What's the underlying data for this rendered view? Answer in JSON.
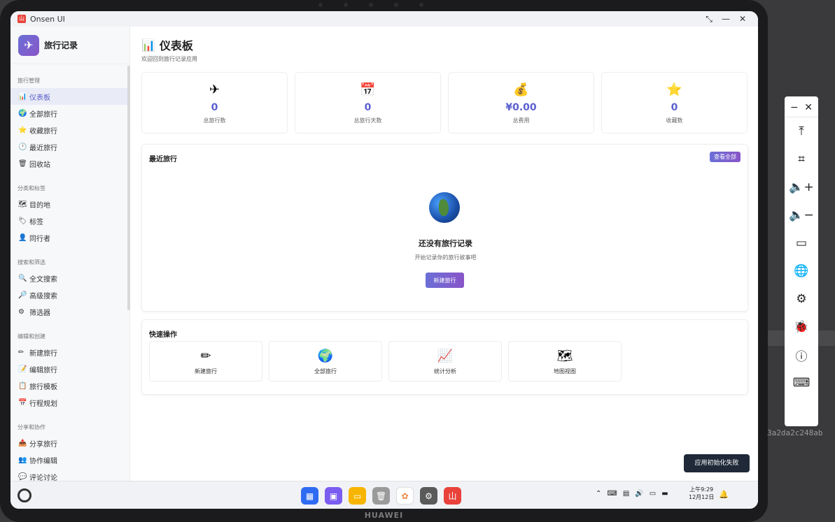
{
  "window": {
    "title": "Onsen UI"
  },
  "device": {
    "brand": "HUAWEI",
    "hash_text": "3a2da2c248ab"
  },
  "emulator": {
    "min": "−",
    "close": "✕",
    "tools": [
      "top-icon",
      "crop-icon",
      "volume-up-icon",
      "volume-down-icon",
      "battery-icon",
      "globe-icon",
      "settings-icon",
      "bug-icon",
      "info-icon",
      "keyboard-icon"
    ]
  },
  "sidebar": {
    "app_name": "旅行记录",
    "sections": [
      {
        "title": "旅行管理",
        "items": [
          {
            "icon": "📊",
            "label": "仪表板",
            "active": true
          },
          {
            "icon": "🌍",
            "label": "全部旅行"
          },
          {
            "icon": "⭐",
            "label": "收藏旅行"
          },
          {
            "icon": "🕐",
            "label": "最近旅行"
          },
          {
            "icon": "🗑",
            "label": "回收站"
          }
        ]
      },
      {
        "title": "分类和标签",
        "items": [
          {
            "icon": "🗺",
            "label": "目的地"
          },
          {
            "icon": "🏷",
            "label": "标签"
          },
          {
            "icon": "👤",
            "label": "同行者"
          }
        ]
      },
      {
        "title": "搜索和筛选",
        "items": [
          {
            "icon": "🔍",
            "label": "全文搜索"
          },
          {
            "icon": "🔎",
            "label": "高级搜索"
          },
          {
            "icon": "⚙",
            "label": "筛选器"
          }
        ]
      },
      {
        "title": "编辑和创建",
        "items": [
          {
            "icon": "✏",
            "label": "新建旅行"
          },
          {
            "icon": "📝",
            "label": "编辑旅行"
          },
          {
            "icon": "📋",
            "label": "旅行模板"
          },
          {
            "icon": "📅",
            "label": "行程规划"
          }
        ]
      },
      {
        "title": "分享和协作",
        "items": [
          {
            "icon": "📤",
            "label": "分享旅行"
          },
          {
            "icon": "👥",
            "label": "协作编辑"
          },
          {
            "icon": "💬",
            "label": "评论讨论"
          }
        ]
      }
    ]
  },
  "main": {
    "title_icon": "📊",
    "title": "仪表板",
    "subtitle": "欢迎回到旅行记录应用",
    "stats": [
      {
        "icon": "✈",
        "value": "0",
        "label": "总旅行数"
      },
      {
        "icon": "📅",
        "value": "0",
        "label": "总旅行天数"
      },
      {
        "icon": "💰",
        "value": "¥0.00",
        "label": "总费用"
      },
      {
        "icon": "⭐",
        "value": "0",
        "label": "收藏数"
      }
    ],
    "recent": {
      "title": "最近旅行",
      "view_all": "查看全部",
      "empty_title": "还没有旅行记录",
      "empty_sub": "开始记录你的旅行故事吧",
      "new_button": "新建旅行"
    },
    "quick": {
      "title": "快速操作",
      "items": [
        {
          "icon": "✏",
          "label": "新建旅行"
        },
        {
          "icon": "🌍",
          "label": "全部旅行"
        },
        {
          "icon": "📈",
          "label": "统计分析"
        },
        {
          "icon": "🗺",
          "label": "地图视图"
        }
      ]
    }
  },
  "toast": "应用初始化失败",
  "taskbar": {
    "clock_time": "上午9:29",
    "clock_date": "12月12日",
    "dock_colors": [
      "#2f6bf2",
      "#7b5cf0",
      "#f7b500",
      "#9a9a9a",
      "#ffffff",
      "#5a5a5a",
      "#e8423a"
    ]
  }
}
